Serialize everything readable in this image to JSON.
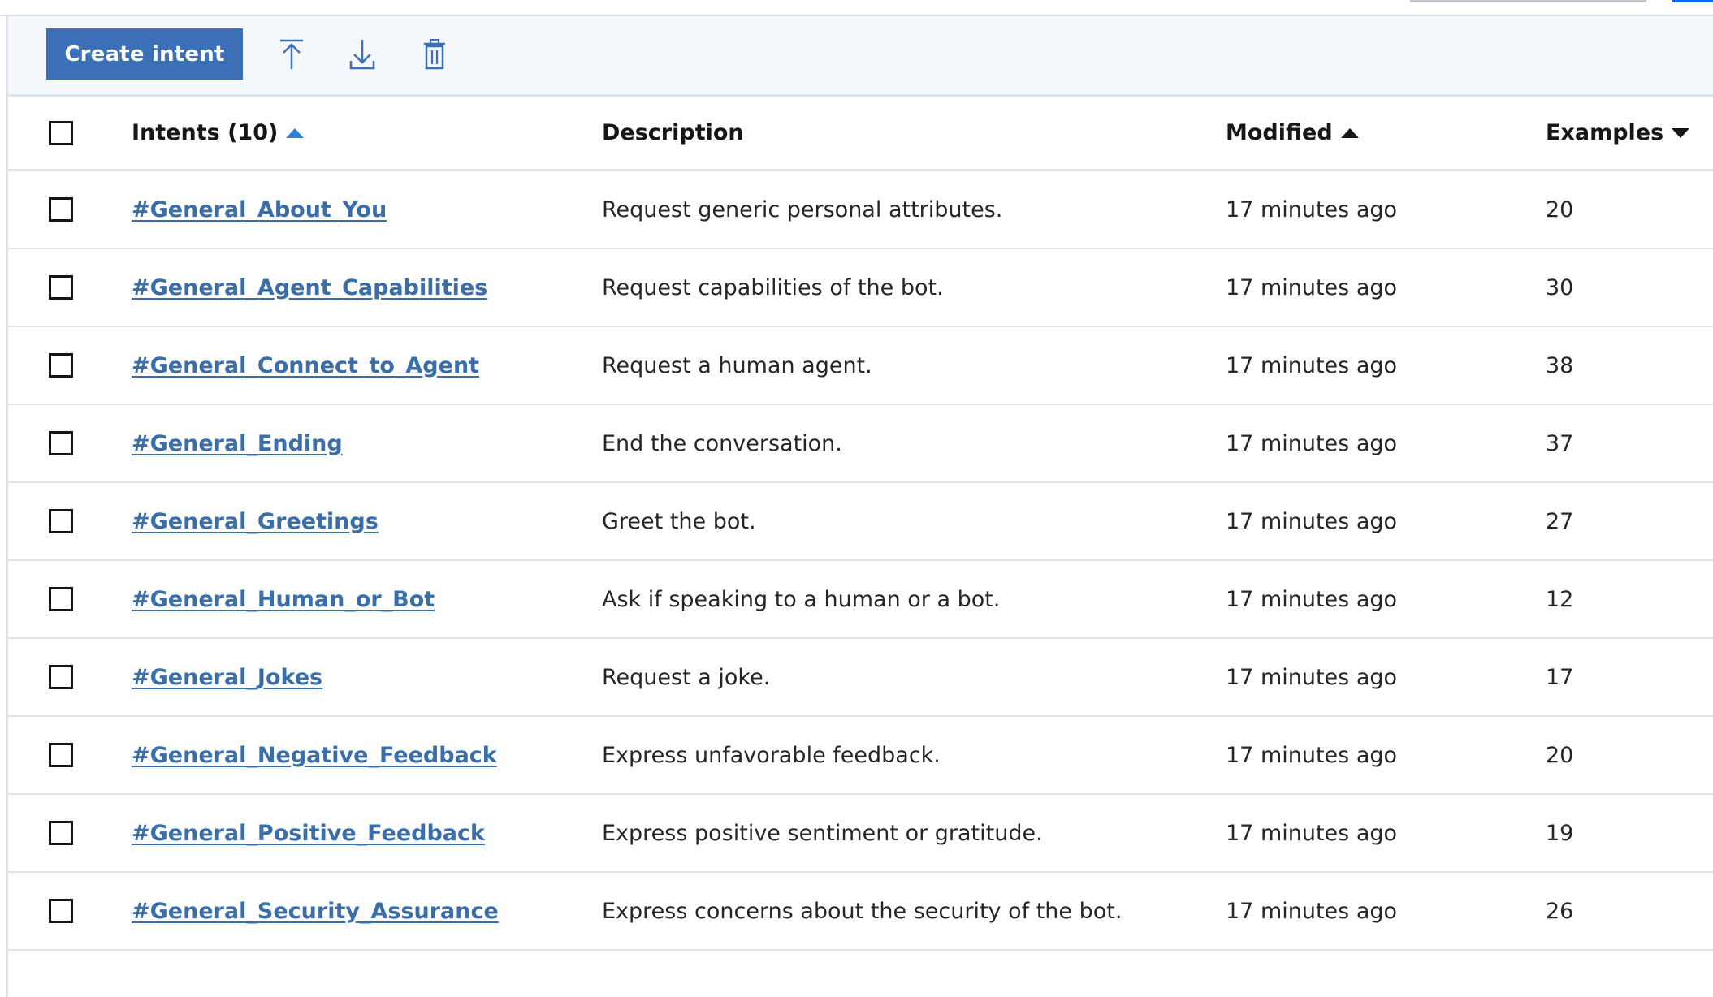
{
  "toolbar": {
    "create_label": "Create intent",
    "upload_icon": "upload-icon",
    "download_icon": "download-icon",
    "delete_icon": "trash-icon"
  },
  "colors": {
    "primary_button": "#3b6fb6",
    "link": "#3a6ea8",
    "active_sort": "#2f80d9",
    "toolbar_bg": "#f4f7fb"
  },
  "table": {
    "headers": {
      "intents": "Intents (10)",
      "description": "Description",
      "modified": "Modified",
      "examples": "Examples"
    },
    "rows": [
      {
        "name": "#General_About_You",
        "description": "Request generic personal attributes.",
        "modified": "17 minutes ago",
        "examples": "20"
      },
      {
        "name": "#General_Agent_Capabilities",
        "description": "Request capabilities of the bot.",
        "modified": "17 minutes ago",
        "examples": "30"
      },
      {
        "name": "#General_Connect_to_Agent",
        "description": "Request a human agent.",
        "modified": "17 minutes ago",
        "examples": "38"
      },
      {
        "name": "#General_Ending",
        "description": "End the conversation.",
        "modified": "17 minutes ago",
        "examples": "37"
      },
      {
        "name": "#General_Greetings",
        "description": "Greet the bot.",
        "modified": "17 minutes ago",
        "examples": "27"
      },
      {
        "name": "#General_Human_or_Bot",
        "description": "Ask if speaking to a human or a bot.",
        "modified": "17 minutes ago",
        "examples": "12"
      },
      {
        "name": "#General_Jokes",
        "description": "Request a joke.",
        "modified": "17 minutes ago",
        "examples": "17"
      },
      {
        "name": "#General_Negative_Feedback",
        "description": "Express unfavorable feedback.",
        "modified": "17 minutes ago",
        "examples": "20"
      },
      {
        "name": "#General_Positive_Feedback",
        "description": "Express positive sentiment or gratitude.",
        "modified": "17 minutes ago",
        "examples": "19"
      },
      {
        "name": "#General_Security_Assurance",
        "description": "Express concerns about the security of the bot.",
        "modified": "17 minutes ago",
        "examples": "26"
      }
    ]
  }
}
